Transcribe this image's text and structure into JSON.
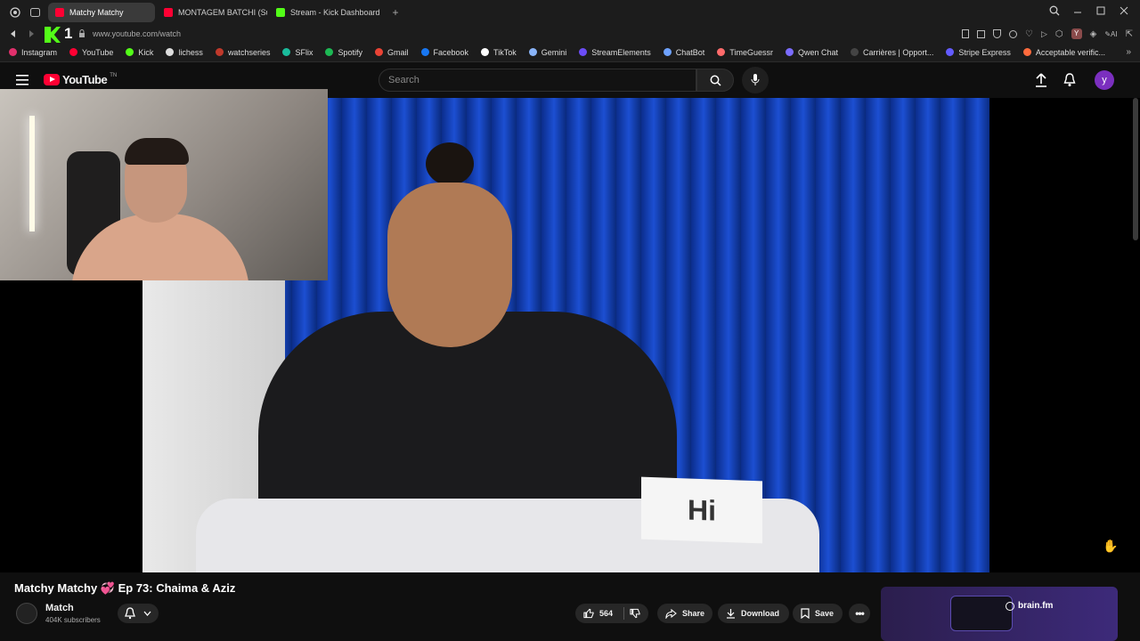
{
  "browser": {
    "tabs": [
      {
        "label": "Matchy Matchy",
        "color": "#ff0033",
        "active": true
      },
      {
        "label": "MONTAGEM BATCHI (Sup",
        "color": "#ff0033",
        "active": false
      },
      {
        "label": "Stream - Kick Dashboard",
        "color": "#53fc18",
        "active": false
      }
    ],
    "new_tab": "+",
    "url": "www.youtube.com/watch",
    "bookmarks": [
      {
        "label": "Instagram",
        "color": "#e1306c"
      },
      {
        "label": "YouTube",
        "color": "#ff0033"
      },
      {
        "label": "Kick",
        "color": "#53fc18"
      },
      {
        "label": "lichess",
        "color": "#dddddd"
      },
      {
        "label": "watchseries",
        "color": "#c0392b"
      },
      {
        "label": "SFlix",
        "color": "#1abc9c"
      },
      {
        "label": "Spotify",
        "color": "#1db954"
      },
      {
        "label": "Gmail",
        "color": "#ea4335"
      },
      {
        "label": "Facebook",
        "color": "#1877f2"
      },
      {
        "label": "TikTok",
        "color": "#ffffff"
      },
      {
        "label": "Gemini",
        "color": "#8ab4f8"
      },
      {
        "label": "StreamElements",
        "color": "#6b4cf6"
      },
      {
        "label": "ChatBot",
        "color": "#6ea2ff"
      },
      {
        "label": "TimeGuessr",
        "color": "#ff6b6b"
      },
      {
        "label": "Qwen Chat",
        "color": "#7b6cff"
      },
      {
        "label": "Carrières | Opport...",
        "color": "#444444"
      },
      {
        "label": "Stripe Express",
        "color": "#635bff"
      },
      {
        "label": "Acceptable verific...",
        "color": "#ff6b3d"
      }
    ]
  },
  "youtube": {
    "logo_text": "YouTube",
    "logo_sup": "TN",
    "search_placeholder": "Search",
    "user_initial": "y"
  },
  "video": {
    "name_card_text": "Hi",
    "title": "Matchy Matchy 💞 Ep 73: Chaima & Aziz",
    "channel_name": "Match",
    "subscribers": "404K subscribers",
    "likes": "564",
    "share_label": "Share",
    "download_label": "Download",
    "save_label": "Save"
  },
  "ad": {
    "brand": "brain.fm"
  },
  "colors": {
    "accent": "#ff0033",
    "avatar": "#7b2fbf"
  }
}
